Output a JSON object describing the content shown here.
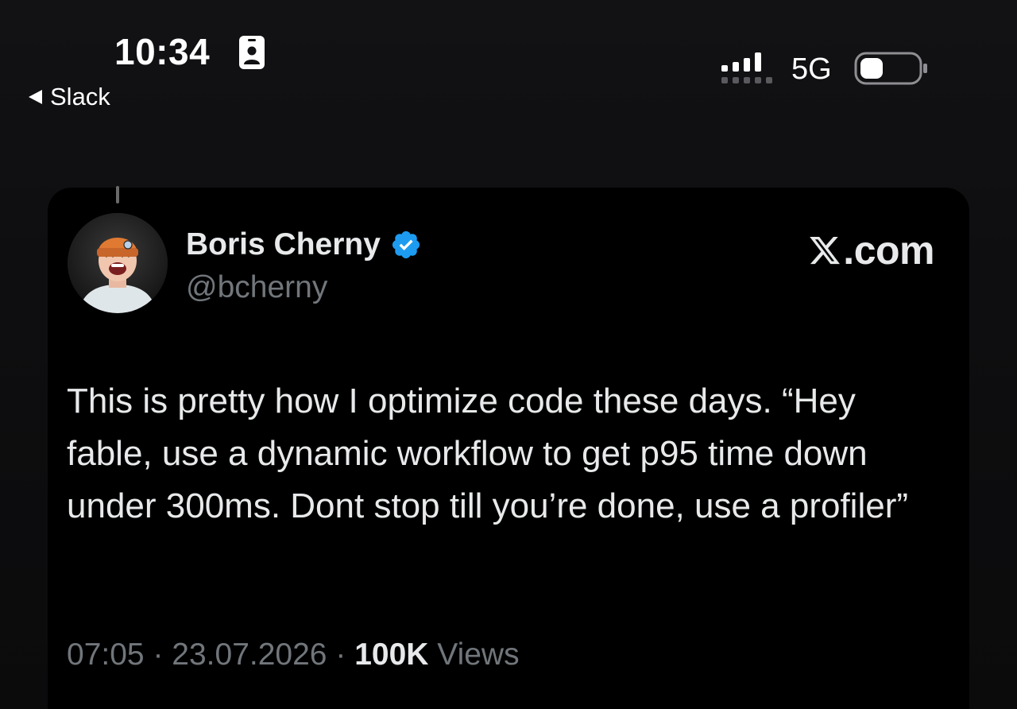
{
  "status_bar": {
    "time": "10:34",
    "back_label": "Slack",
    "network": "5G",
    "icons": [
      "id-card-icon",
      "signal-icon",
      "battery-icon"
    ]
  },
  "tweet": {
    "author_name": "Boris Cherny",
    "handle": "@bcherny",
    "verified": true,
    "site": ".com",
    "text": "This is pretty how I optimize code these days. “Hey fable, use a dynamic workflow to get p95 time down under 300ms. Dont stop till you’re done, use a profiler”",
    "time": "07:05",
    "separator": "·",
    "date": "23.07.2026",
    "views_count": "100K",
    "views_label": "Views"
  },
  "colors": {
    "background": "#121214",
    "card": "#000000",
    "text_primary": "#e7e9ea",
    "text_secondary": "#71767b",
    "verified_blue": "#1d9bf0"
  }
}
